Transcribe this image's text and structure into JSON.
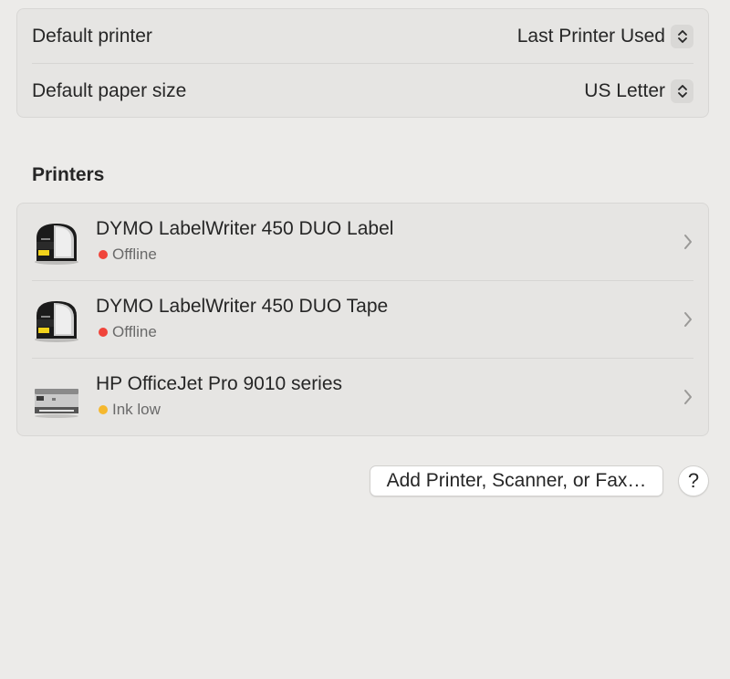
{
  "defaults": {
    "default_printer": {
      "label": "Default printer",
      "value": "Last Printer Used"
    },
    "default_paper_size": {
      "label": "Default paper size",
      "value": "US Letter"
    }
  },
  "printers_section": {
    "title": "Printers",
    "items": [
      {
        "name": "DYMO LabelWriter 450 DUO Label",
        "status": "Offline",
        "status_color": "#f0443a",
        "icon": "label-printer-icon"
      },
      {
        "name": "DYMO LabelWriter 450 DUO Tape",
        "status": "Offline",
        "status_color": "#f0443a",
        "icon": "label-printer-icon"
      },
      {
        "name": "HP OfficeJet Pro 9010 series",
        "status": "Ink low",
        "status_color": "#f5b82e",
        "icon": "inkjet-printer-icon"
      }
    ]
  },
  "actions": {
    "add_label": "Add Printer, Scanner, or Fax…",
    "help_label": "?"
  }
}
